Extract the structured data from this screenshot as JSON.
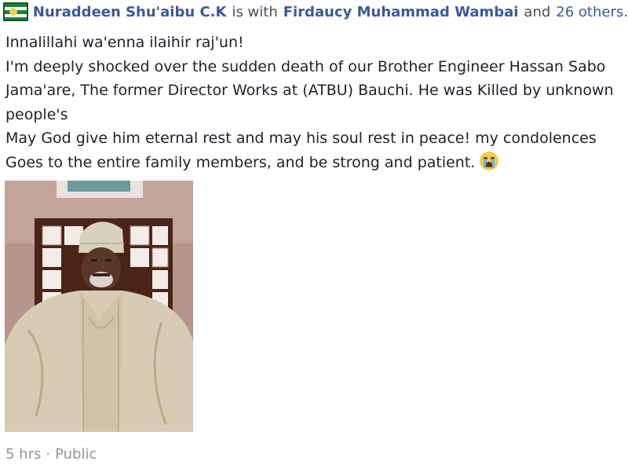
{
  "post": {
    "author": "Nuraddeen Shu'aibu C.K",
    "with_text": "is with",
    "tagged": "Firdaucy Muhammad Wambai",
    "and_text": "and",
    "others": "26 others",
    "period": ".",
    "lines": [
      "Innalillahi wa'enna ilaihir raj'un!",
      "I'm  deeply shocked over the sudden death of our Brother Engineer Hassan Sabo",
      "Jama'are,  The former Director Works at (ATBU)  Bauchi. He was Killed by unknown",
      "people's",
      "May God give him eternal rest and may his soul rest in peace! my condolences",
      "Goes to the entire family members, and be strong and patient."
    ],
    "emoji": "crying-face-icon",
    "time": "5 hrs",
    "separator": "·",
    "privacy": "Public"
  },
  "colors": {
    "link": "#3b5998",
    "text": "#1d2129",
    "meta": "#90949c"
  }
}
